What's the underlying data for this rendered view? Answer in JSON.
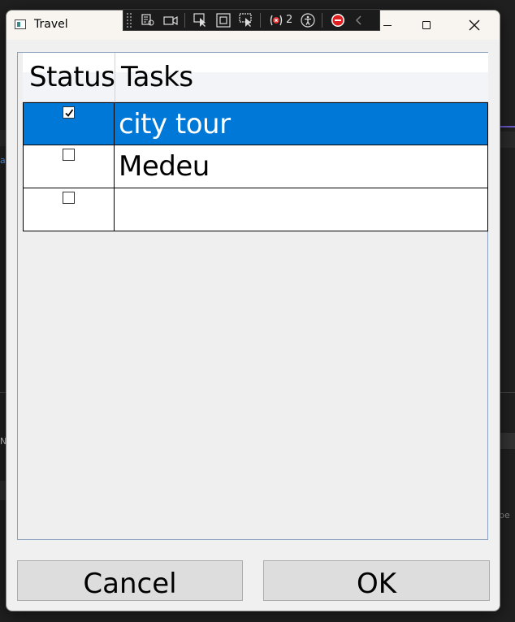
{
  "window": {
    "title": "Travel"
  },
  "devtools": {
    "error_count": "2"
  },
  "grid": {
    "columns": [
      "Status",
      "Tasks"
    ],
    "rows": [
      {
        "checked": true,
        "task": "city tour",
        "selected": true
      },
      {
        "checked": false,
        "task": "Medeu",
        "selected": false
      },
      {
        "checked": false,
        "task": "",
        "selected": false
      }
    ]
  },
  "buttons": {
    "cancel": "Cancel",
    "ok": "OK"
  },
  "colors": {
    "selection": "#0078d7",
    "button_face": "#dddddd",
    "window_bg": "#f0f0f0"
  },
  "background": {
    "left_letters": [
      "a",
      "N"
    ],
    "right_text": "be"
  }
}
